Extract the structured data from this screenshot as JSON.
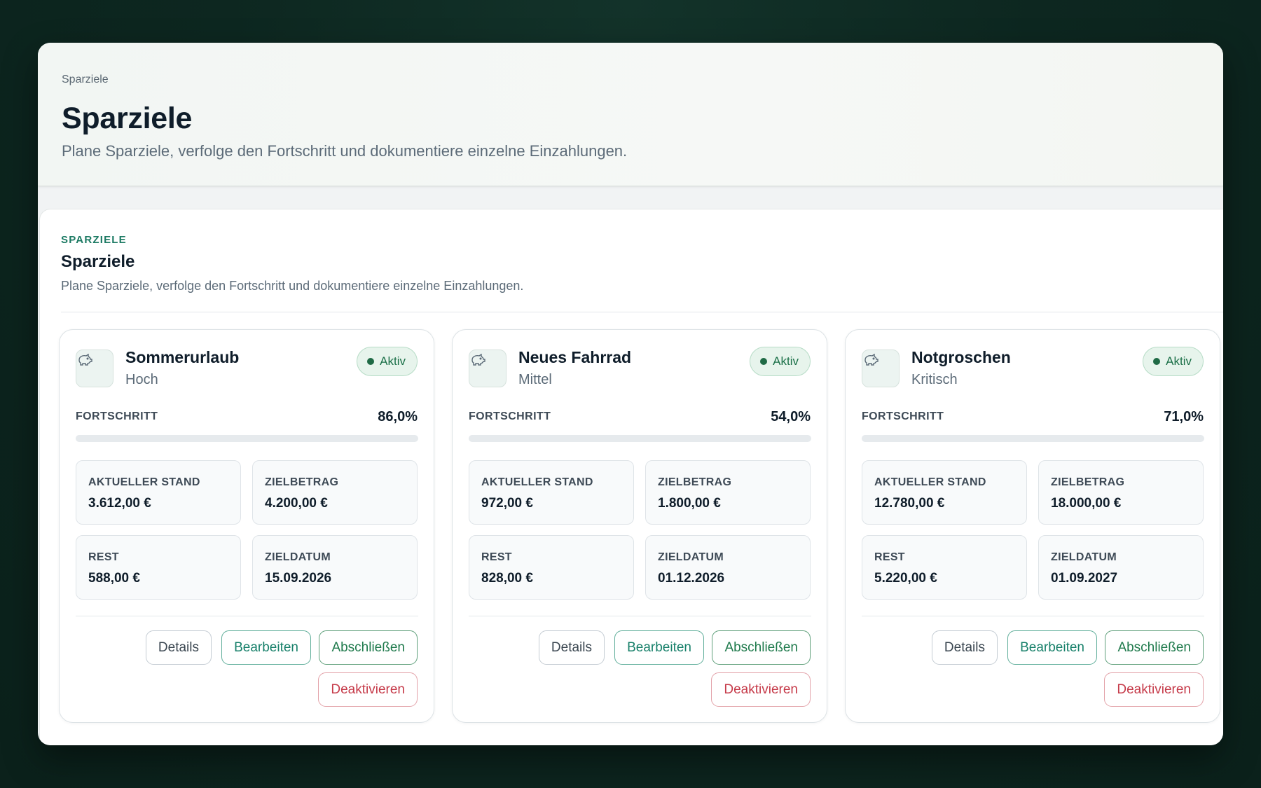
{
  "header": {
    "breadcrumb": "Sparziele",
    "title": "Sparziele",
    "subtitle": "Plane Sparziele, verfolge den Fortschritt und dokumentiere einzelne Einzahlungen."
  },
  "section": {
    "eyebrow": "SPARZIELE",
    "title": "Sparziele",
    "subtitle": "Plane Sparziele, verfolge den Fortschritt und dokumentiere einzelne Einzahlungen."
  },
  "labels": {
    "progress": "FORTSCHRITT",
    "current": "AKTUELLER STAND",
    "target": "ZIELBETRAG",
    "rest": "REST",
    "date": "ZIELDATUM",
    "details": "Details",
    "edit": "Bearbeiten",
    "complete": "Abschließen",
    "deactivate": "Deaktivieren"
  },
  "goals": [
    {
      "name": "Sommerurlaub",
      "priority": "Hoch",
      "status": "Aktiv",
      "progress_label": "86,0%",
      "progress": 0.86,
      "current": "3.612,00 €",
      "target": "4.200,00 €",
      "rest": "588,00 €",
      "date": "15.09.2026",
      "icon": "piggy-bank-icon"
    },
    {
      "name": "Neues Fahrrad",
      "priority": "Mittel",
      "status": "Aktiv",
      "progress_label": "54,0%",
      "progress": 0.54,
      "current": "972,00 €",
      "target": "1.800,00 €",
      "rest": "828,00 €",
      "date": "01.12.2026",
      "icon": "piggy-bank-icon"
    },
    {
      "name": "Notgroschen",
      "priority": "Kritisch",
      "status": "Aktiv",
      "progress_label": "71,0%",
      "progress": 0.71,
      "current": "12.780,00 €",
      "target": "18.000,00 €",
      "rest": "5.220,00 €",
      "date": "01.09.2027",
      "icon": "piggy-bank-icon"
    }
  ],
  "colors": {
    "accent": "#1c7a63",
    "active_badge": "#e7f4ec",
    "danger": "#c63b4a",
    "progress_track": "#e6eaed"
  }
}
